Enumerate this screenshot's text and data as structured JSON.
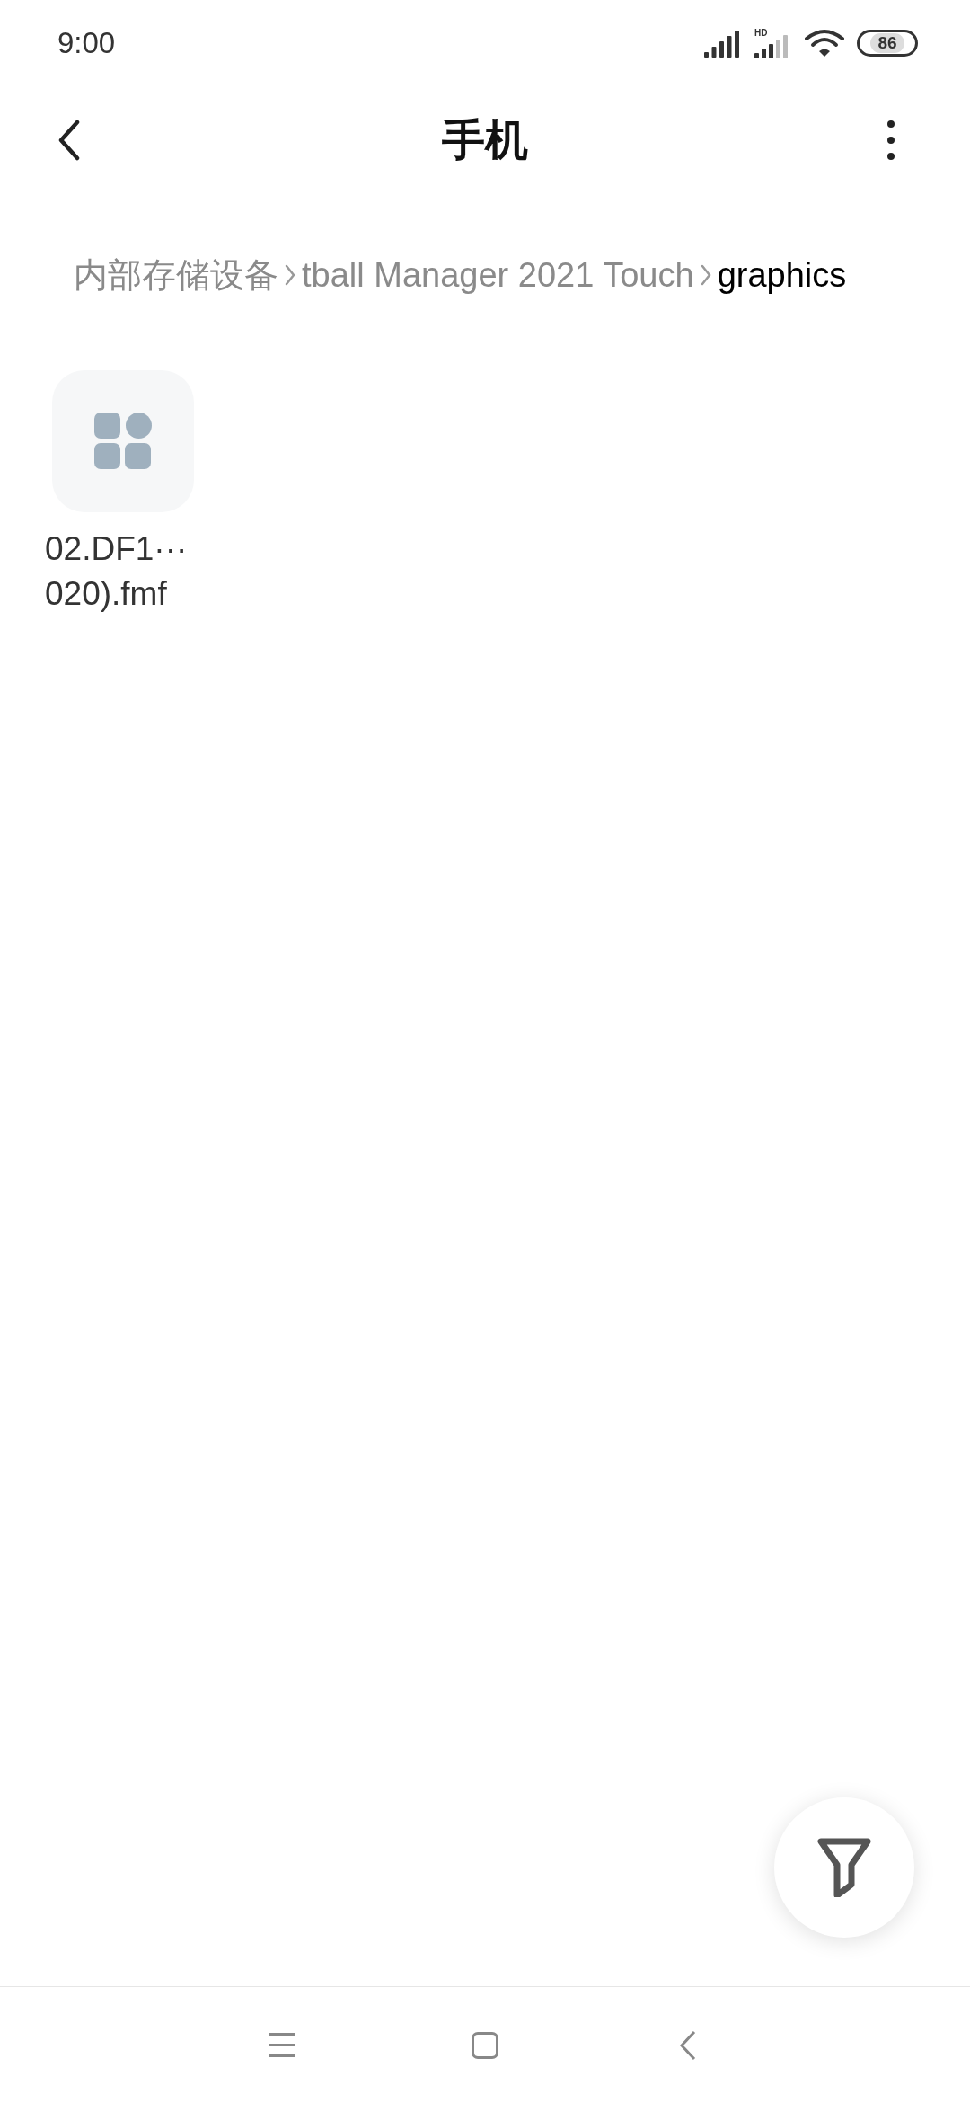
{
  "status_bar": {
    "time": "9:00",
    "battery": "86",
    "network_label": "HD"
  },
  "header": {
    "title": "手机"
  },
  "breadcrumb": [
    {
      "label": "内部存储设备",
      "current": false
    },
    {
      "label": "tball Manager 2021 Touch",
      "current": false
    },
    {
      "label": "graphics",
      "current": true
    }
  ],
  "files": [
    {
      "name_lines": [
        "02.DF1···",
        "020).fmf"
      ]
    }
  ]
}
